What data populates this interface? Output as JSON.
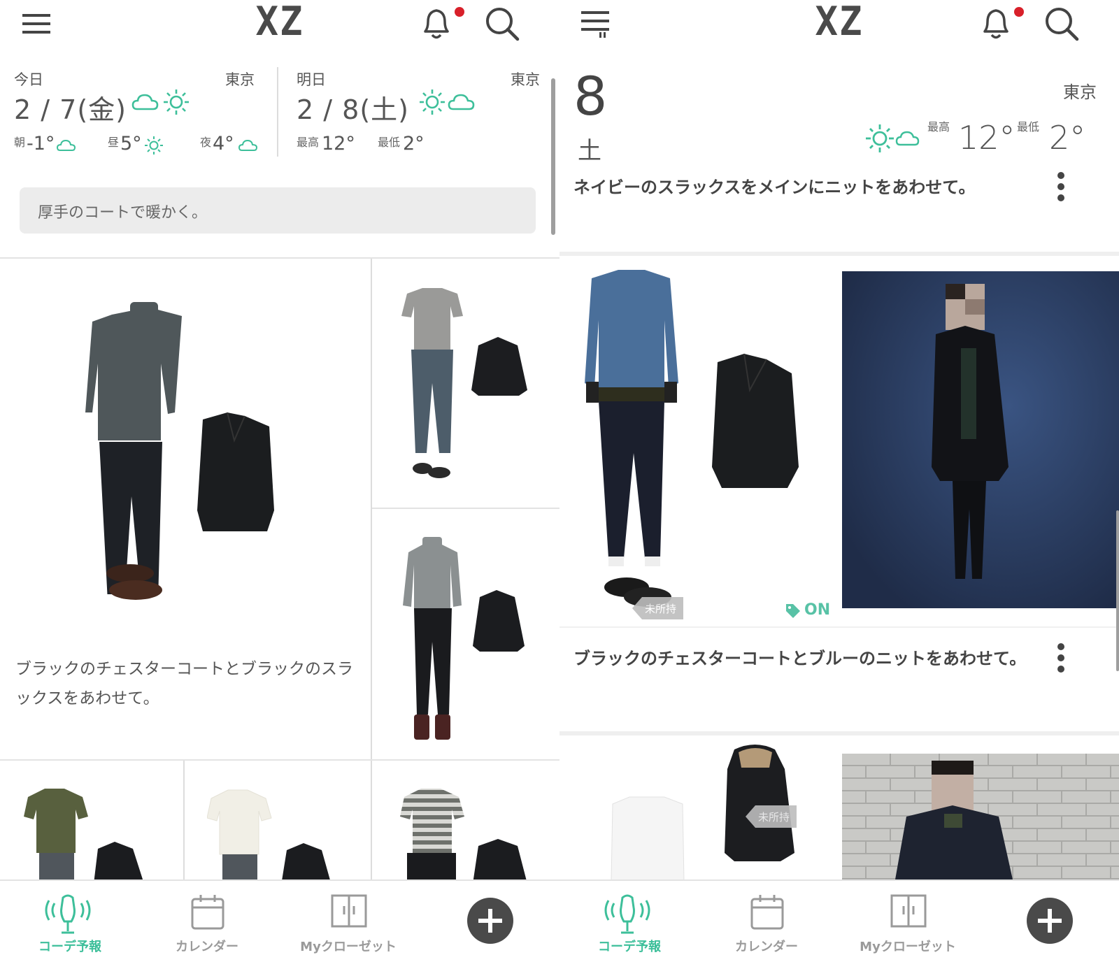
{
  "header": {
    "logo": "XZ"
  },
  "left": {
    "today": {
      "label": "今日",
      "city": "東京",
      "date": "2 / 7(金)",
      "morning_label": "朝",
      "morning_temp": "-1°",
      "noon_label": "昼",
      "noon_temp": "5°",
      "night_label": "夜",
      "night_temp": "4°"
    },
    "tomorrow": {
      "label": "明日",
      "city": "東京",
      "date": "2 / 8(土)",
      "high_label": "最高",
      "high_temp": "12°",
      "low_label": "最低",
      "low_temp": "2°"
    },
    "tip": "厚手のコートで暖かく。",
    "main_caption": "ブラックのチェスターコートとブラックのスラックスをあわせて。"
  },
  "right": {
    "day": "8",
    "weekday": "土",
    "city": "東京",
    "high_label": "最高",
    "high_temp": "12°",
    "low_label": "最低",
    "low_temp": "2°",
    "headline": "ネイビーのスラックスをメインにニットをあわせて。",
    "tag_not_owned": "未所持",
    "tag_on": "ON",
    "card_caption": "ブラックのチェスターコートとブルーのニットをあわせて。",
    "tag_not_owned_2": "未所持"
  },
  "nav": {
    "forecast": "コーデ予報",
    "calendar": "カレンダー",
    "closet": "Myクローゼット"
  },
  "colors": {
    "accent": "#3dbf9a",
    "alert": "#d8202a",
    "dark": "#4a4a4a"
  }
}
